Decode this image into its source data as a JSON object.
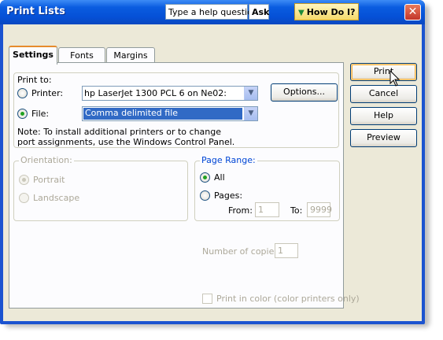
{
  "window": {
    "title": "Print Lists",
    "help_placeholder": "Type a help question",
    "ask_label": "Ask",
    "how_do_i_label": "How Do I?",
    "close_symbol": "✕"
  },
  "tabs": [
    {
      "label": "Settings",
      "active": true
    },
    {
      "label": "Fonts",
      "active": false
    },
    {
      "label": "Margins",
      "active": false
    }
  ],
  "print_to": {
    "label": "Print to:",
    "printer_label": "Printer:",
    "printer_value": "hp LaserJet 1300 PCL 6 on Ne02:",
    "file_label": "File:",
    "file_value": "Comma delimited file",
    "selected": "File",
    "options_button": "Options...",
    "note": "Note: To install additional printers or to change port assignments, use the Windows Control Panel."
  },
  "orientation": {
    "label": "Orientation:",
    "portrait": "Portrait",
    "landscape": "Landscape",
    "selected": "Portrait",
    "enabled": false
  },
  "page_range": {
    "label": "Page Range:",
    "all": "All",
    "pages": "Pages:",
    "selected": "All",
    "from_label": "From:",
    "from_value": "1",
    "to_label": "To:",
    "to_value": "9999"
  },
  "copies": {
    "label": "Number of copies:",
    "value": "1"
  },
  "color": {
    "label": "Print in color (color printers only)",
    "checked": false
  },
  "buttons": {
    "print": "Print",
    "cancel": "Cancel",
    "help": "Help",
    "preview": "Preview"
  },
  "colors": {
    "title_bar": "#0550d6",
    "dialog_bg": "#ece9d8",
    "group_label": "#0046d5",
    "selection": "#316ac5",
    "radio_dot": "#21a121"
  }
}
